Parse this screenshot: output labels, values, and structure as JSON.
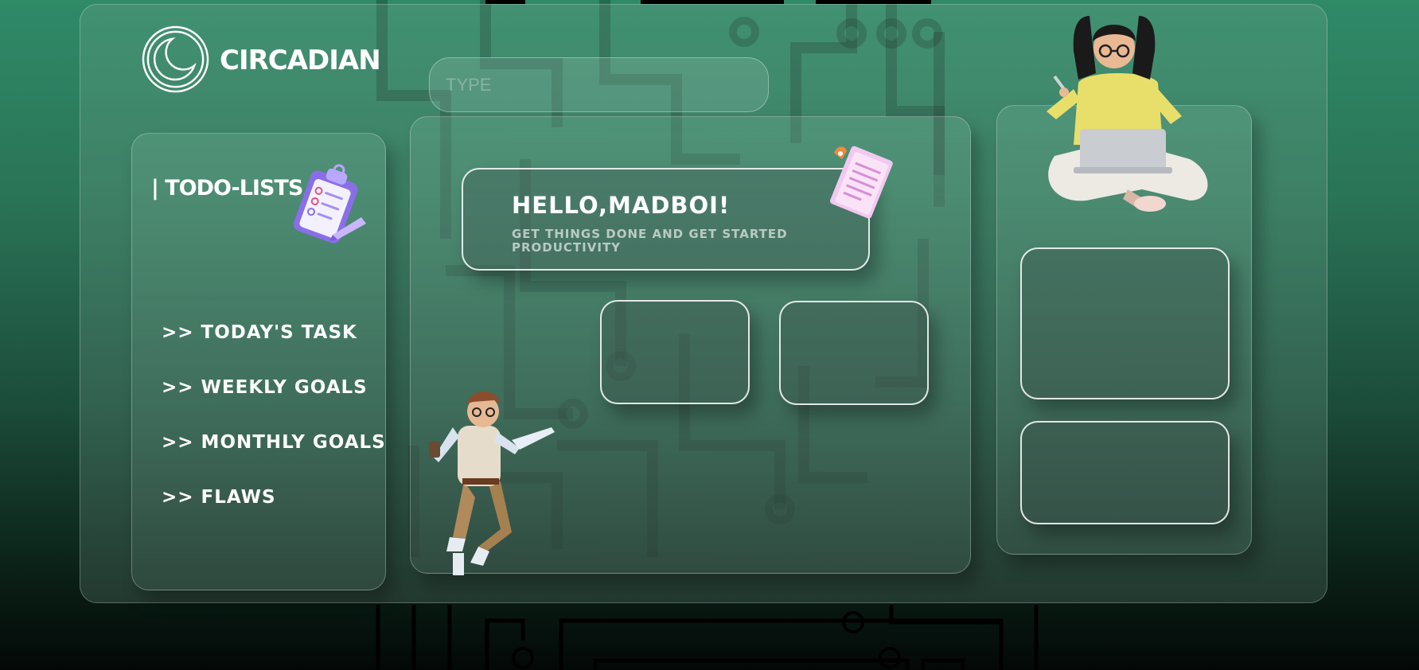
{
  "app": {
    "brand_name": "CIRCADIAN",
    "accent_color": "#2f8a68"
  },
  "search": {
    "placeholder": "TYPE"
  },
  "sidebar": {
    "title": "| TODO-LISTS",
    "items": [
      {
        "label": ">> TODAY'S TASK"
      },
      {
        "label": ">> WEEKLY GOALS"
      },
      {
        "label": ">> MONTHLY GOALS"
      },
      {
        "label": ">> FLAWS"
      }
    ]
  },
  "greeting": {
    "title": "HELLO,MADBOI!",
    "subtitle": "GET THINGS DONE AND GET STARTED PRODUCTIVITY"
  },
  "icons": {
    "logo": "moon-logo-icon",
    "clipboard": "clipboard-checklist-icon",
    "paper": "document-rocket-icon"
  }
}
